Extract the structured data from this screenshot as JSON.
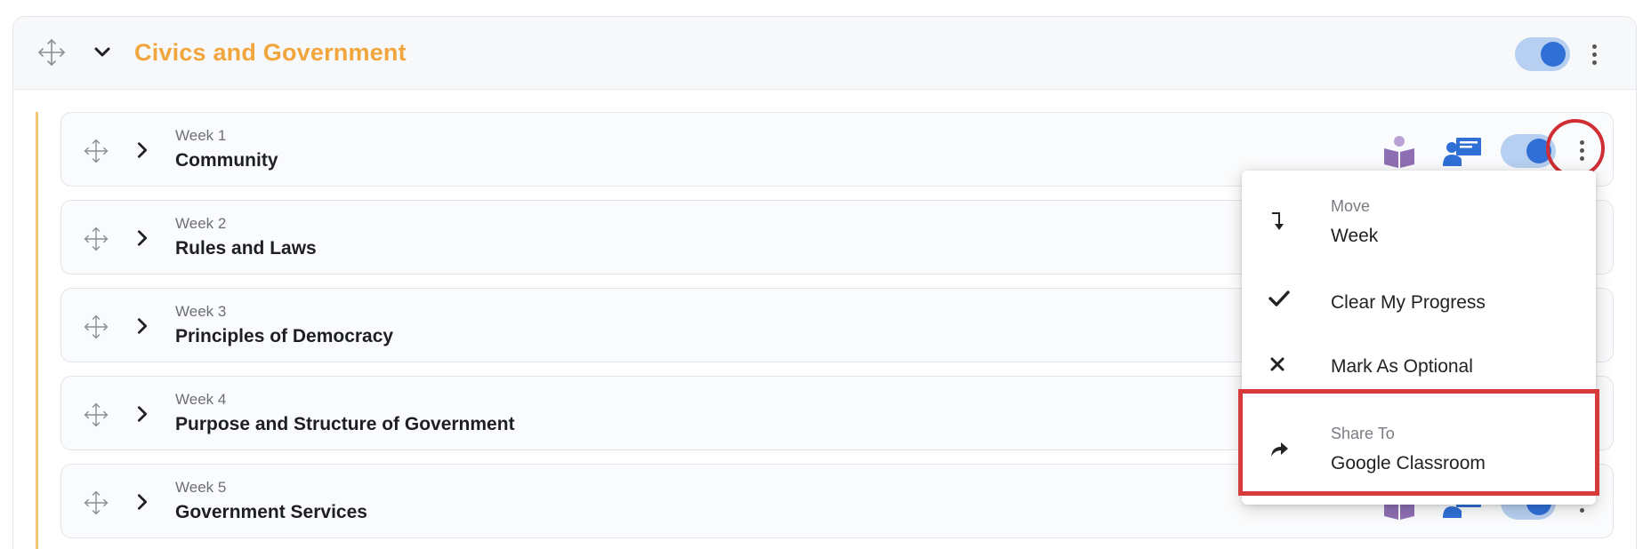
{
  "unit": {
    "title": "Civics and Government",
    "toggle_on": true
  },
  "weeks": [
    {
      "label": "Week 1",
      "title": "Community"
    },
    {
      "label": "Week 2",
      "title": "Rules and Laws"
    },
    {
      "label": "Week 3",
      "title": "Principles of Democracy"
    },
    {
      "label": "Week 4",
      "title": "Purpose and Structure of Government"
    },
    {
      "label": "Week 5",
      "title": "Government Services"
    }
  ],
  "context_menu": {
    "items": [
      {
        "sublabel": "Move",
        "label": "Week",
        "icon": "move-down-icon"
      },
      {
        "label": "Clear My Progress",
        "icon": "check-icon"
      },
      {
        "label": "Mark As Optional",
        "icon": "optional-icon"
      },
      {
        "sublabel": "Share To",
        "label": "Google Classroom",
        "icon": "share-icon"
      }
    ]
  },
  "colors": {
    "unit_title": "#f0a63c",
    "toggle_track": "#b7cff0",
    "toggle_knob": "#2f6fd6",
    "highlight": "#d63a3a",
    "reader_icon": "#8e6fb3",
    "teacher_icon": "#2f6fd6"
  }
}
